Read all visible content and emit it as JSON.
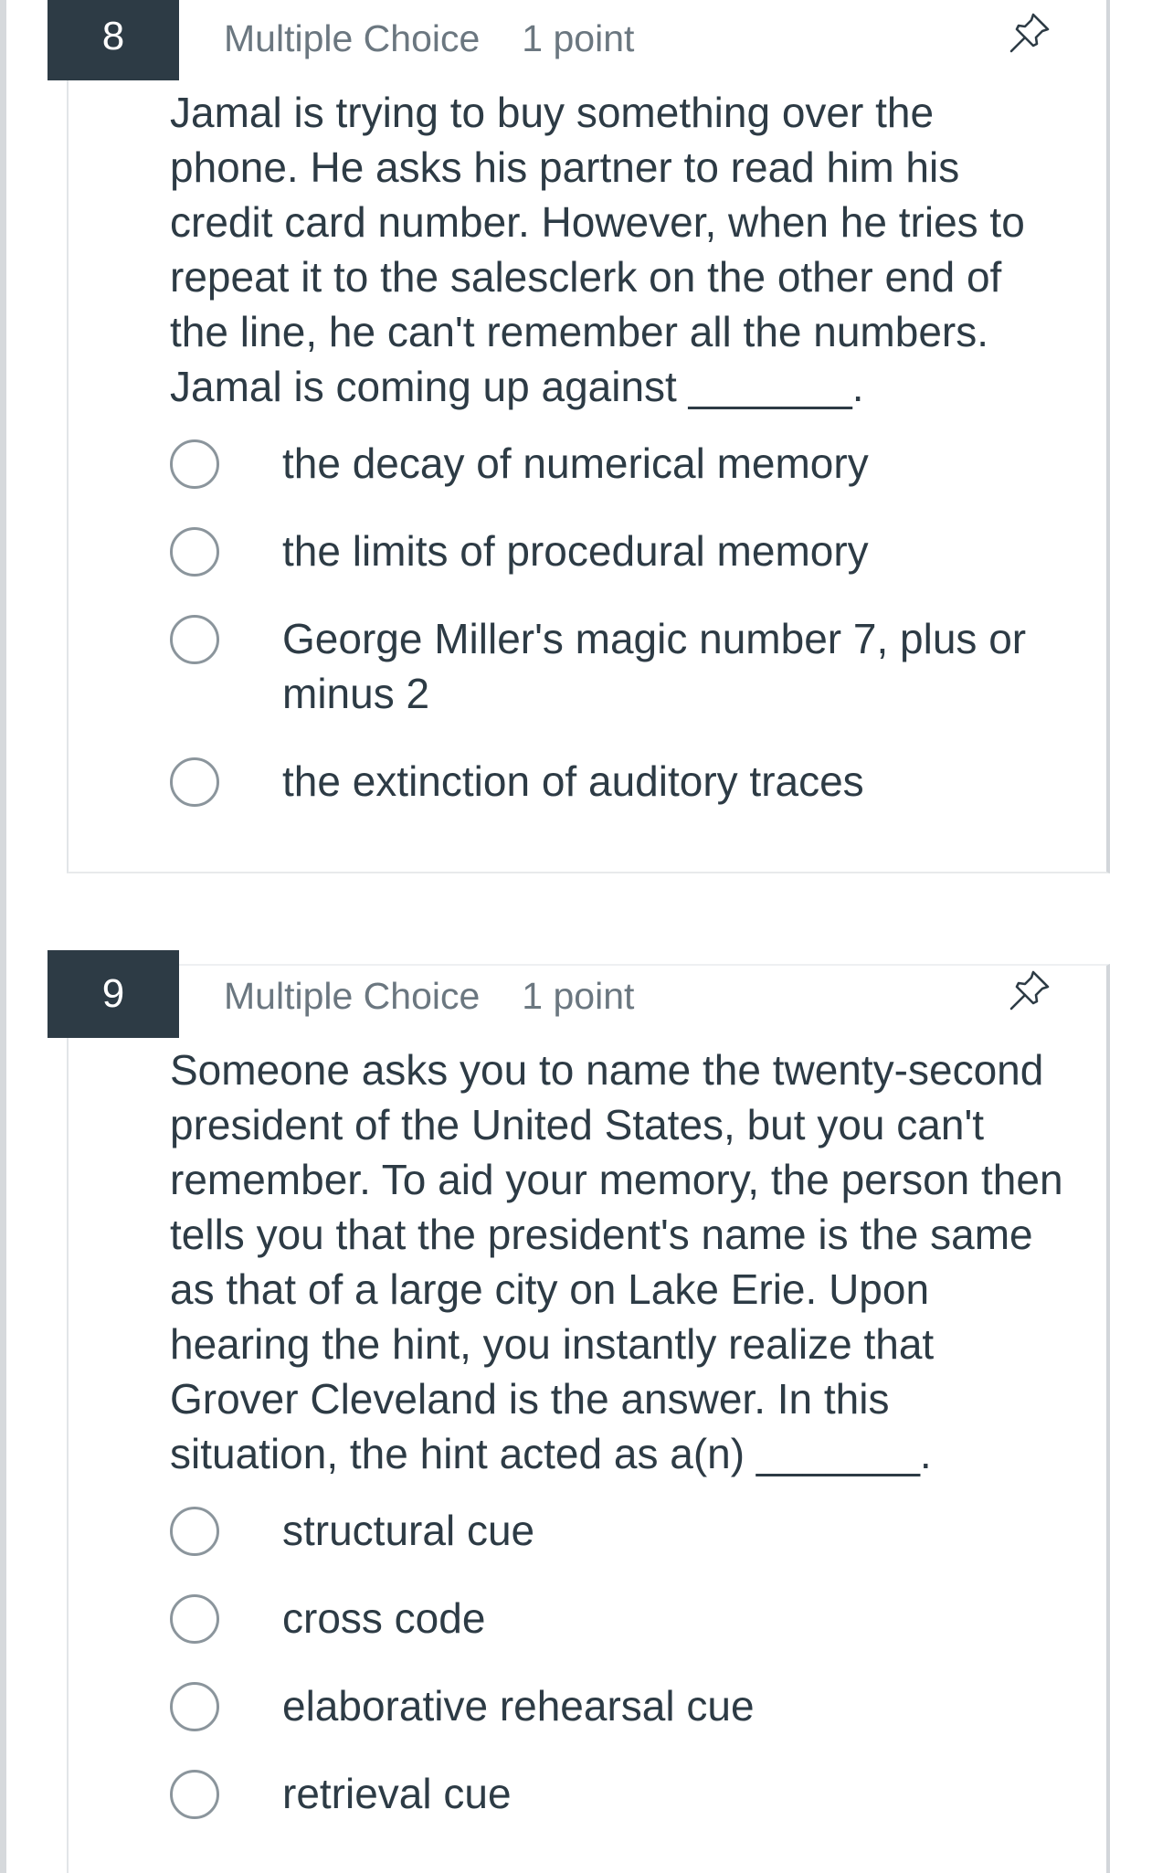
{
  "questions": [
    {
      "number": "8",
      "type": "Multiple Choice",
      "points": "1 point",
      "text": "Jamal is trying to buy something over the phone. He asks his partner to read him his credit card number. However, when he tries to repeat it to the salesclerk on the other end of the line, he can't remember all the numbers. Jamal is coming up against _______.",
      "options": [
        "the decay of numerical memory",
        "the limits of procedural memory",
        "George Miller's magic number 7, plus or minus 2",
        "the extinction of auditory traces"
      ]
    },
    {
      "number": "9",
      "type": "Multiple Choice",
      "points": "1 point",
      "text": "Someone asks you to name the twenty-second president of the United States, but you can't remember. To aid your memory, the person then tells you that the president's name is the same as that of a large city on Lake Erie. Upon hearing the hint, you instantly realize that Grover Cleveland is the answer. In this situation, the hint acted as a(n) _______.",
      "options": [
        "structural cue",
        "cross code",
        "elaborative rehearsal cue",
        "retrieval cue"
      ]
    }
  ],
  "icons": {
    "pin": "pin-icon",
    "radio": "radio-unselected"
  },
  "colors": {
    "question_number_bg": "#2d3b45",
    "text": "#2d3b45",
    "meta_text": "#6b7780",
    "radio_border": "#8b959c"
  }
}
